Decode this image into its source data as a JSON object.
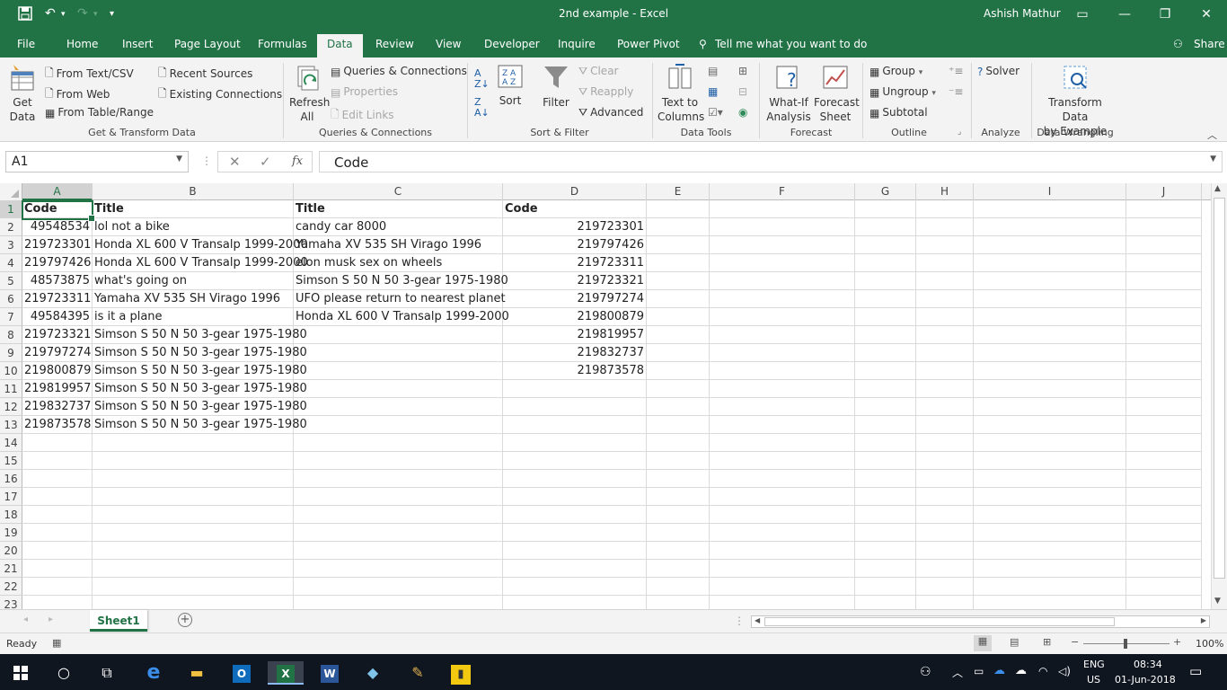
{
  "window": {
    "title": "2nd example  -  Excel",
    "user": "Ashish Mathur"
  },
  "tabs": [
    {
      "label": "File"
    },
    {
      "label": "Home"
    },
    {
      "label": "Insert"
    },
    {
      "label": "Page Layout"
    },
    {
      "label": "Formulas"
    },
    {
      "label": "Data"
    },
    {
      "label": "Review"
    },
    {
      "label": "View"
    },
    {
      "label": "Developer"
    },
    {
      "label": "Inquire"
    },
    {
      "label": "Power Pivot"
    }
  ],
  "tell_me": "Tell me what you want to do",
  "share": "Share",
  "ribbon": {
    "get_data": "Get\nData",
    "from_text": "From Text/CSV",
    "from_web": "From Web",
    "from_table": "From Table/Range",
    "recent_sources": "Recent Sources",
    "existing_connections": "Existing Connections",
    "group1": "Get & Transform Data",
    "refresh_all": "Refresh\nAll",
    "queries_connections": "Queries & Connections",
    "properties": "Properties",
    "edit_links": "Edit Links",
    "group2": "Queries & Connections",
    "sort": "Sort",
    "filter": "Filter",
    "clear": "Clear",
    "reapply": "Reapply",
    "advanced": "Advanced",
    "group3": "Sort & Filter",
    "text_to_columns": "Text to\nColumns",
    "group4": "Data Tools",
    "whatif": "What-If\nAnalysis",
    "forecast_sheet": "Forecast\nSheet",
    "group5": "Forecast",
    "group_btn": "Group",
    "ungroup_btn": "Ungroup",
    "subtotal": "Subtotal",
    "group6": "Outline",
    "solver": "Solver",
    "group7": "Analyze",
    "transform": "Transform Data\nby Example",
    "group8": "Data Wrangling"
  },
  "formula_bar": {
    "name_box": "A1",
    "formula": "Code"
  },
  "columns": [
    "A",
    "B",
    "C",
    "D",
    "E",
    "F",
    "G",
    "H",
    "I",
    "J"
  ],
  "rows": [
    {
      "n": "1",
      "a": "Code",
      "b": "Title",
      "c": "Title",
      "d": "Code"
    },
    {
      "n": "2",
      "a": "49548534",
      "b": "lol not a bike",
      "c": "candy car 8000",
      "d": "219723301"
    },
    {
      "n": "3",
      "a": "219723301",
      "b": "Honda XL 600 V Transalp 1999-2000",
      "c": "Yamaha XV 535 SH Virago 1996",
      "d": "219797426"
    },
    {
      "n": "4",
      "a": "219797426",
      "b": "Honda XL 600 V Transalp 1999-2000",
      "c": "elon musk sex on wheels",
      "d": "219723311"
    },
    {
      "n": "5",
      "a": "48573875",
      "b": "what's going on",
      "c": "Simson S 50 N 50 3-gear 1975-1980",
      "d": "219723321"
    },
    {
      "n": "6",
      "a": "219723311",
      "b": "Yamaha XV 535 SH Virago 1996",
      "c": "UFO please return to nearest planet",
      "d": "219797274"
    },
    {
      "n": "7",
      "a": "49584395",
      "b": "is it a plane",
      "c": "Honda XL 600 V Transalp 1999-2000",
      "d": "219800879"
    },
    {
      "n": "8",
      "a": "219723321",
      "b": "Simson S 50 N 50 3-gear 1975-1980",
      "c": "",
      "d": "219819957"
    },
    {
      "n": "9",
      "a": "219797274",
      "b": "Simson S 50 N 50 3-gear 1975-1980",
      "c": "",
      "d": "219832737"
    },
    {
      "n": "10",
      "a": "219800879",
      "b": "Simson S 50 N 50 3-gear 1975-1980",
      "c": "",
      "d": "219873578"
    },
    {
      "n": "11",
      "a": "219819957",
      "b": "Simson S 50 N 50 3-gear 1975-1980",
      "c": "",
      "d": ""
    },
    {
      "n": "12",
      "a": "219832737",
      "b": "Simson S 50 N 50 3-gear 1975-1980",
      "c": "",
      "d": ""
    },
    {
      "n": "13",
      "a": "219873578",
      "b": "Simson S 50 N 50 3-gear 1975-1980",
      "c": "",
      "d": ""
    },
    {
      "n": "14",
      "a": "",
      "b": "",
      "c": "",
      "d": ""
    },
    {
      "n": "15",
      "a": "",
      "b": "",
      "c": "",
      "d": ""
    },
    {
      "n": "16",
      "a": "",
      "b": "",
      "c": "",
      "d": ""
    },
    {
      "n": "17",
      "a": "",
      "b": "",
      "c": "",
      "d": ""
    },
    {
      "n": "18",
      "a": "",
      "b": "",
      "c": "",
      "d": ""
    },
    {
      "n": "19",
      "a": "",
      "b": "",
      "c": "",
      "d": ""
    },
    {
      "n": "20",
      "a": "",
      "b": "",
      "c": "",
      "d": ""
    },
    {
      "n": "21",
      "a": "",
      "b": "",
      "c": "",
      "d": ""
    },
    {
      "n": "22",
      "a": "",
      "b": "",
      "c": "",
      "d": ""
    },
    {
      "n": "23",
      "a": "",
      "b": "",
      "c": "",
      "d": ""
    }
  ],
  "sheet_tab": "Sheet1",
  "status": {
    "ready": "Ready",
    "zoom": "100%"
  },
  "taskbar": {
    "lang": "ENG",
    "region": "US",
    "time": "08:34",
    "date": "01-Jun-2018"
  },
  "colors": {
    "accent": "#217346",
    "taskbar": "#101620"
  }
}
